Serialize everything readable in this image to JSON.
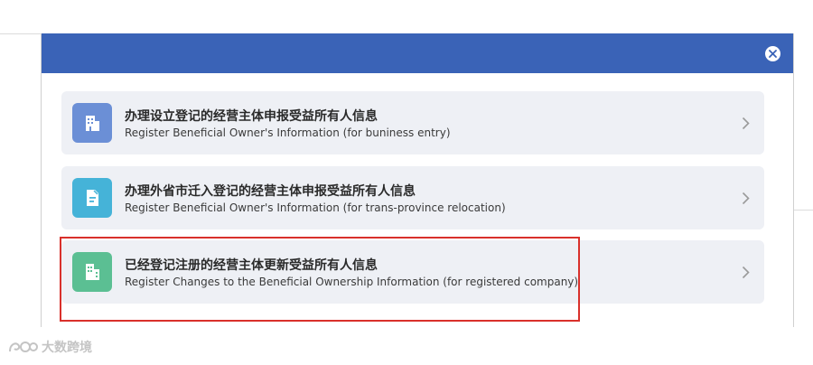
{
  "options": [
    {
      "title": "办理设立登记的经营主体申报受益所有人信息",
      "subtitle": "Register Beneficial Owner's Information (for buniness entry)",
      "icon": "building-icon",
      "icon_color": "#6b8fd6"
    },
    {
      "title": "办理外省市迁入登记的经营主体申报受益所有人信息",
      "subtitle": "Register Beneficial Owner's Information (for trans-province relocation)",
      "icon": "document-edit-icon",
      "icon_color": "#45b3d8"
    },
    {
      "title": "已经登记注册的经营主体更新受益所有人信息",
      "subtitle": "Register Changes to the Beneficial Ownership Information (for registered company)",
      "icon": "building-update-icon",
      "icon_color": "#5bbf93"
    }
  ],
  "header_color": "#3a63b7",
  "highlight_color": "#d9302b",
  "watermark": {
    "text": "大数跨境"
  }
}
